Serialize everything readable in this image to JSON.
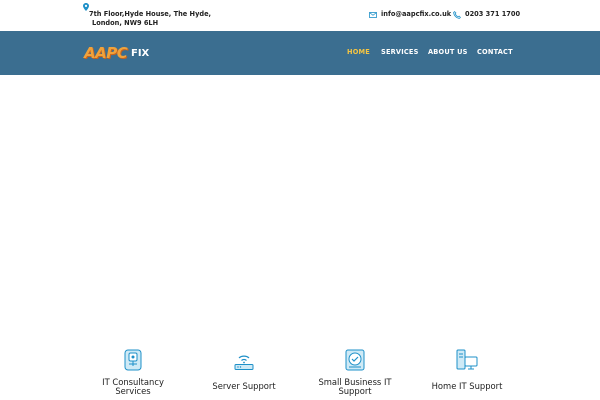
{
  "topbar": {
    "address_line1": "7th Floor,Hyde House, The Hyde,",
    "address_line2": "London, NW9 6LH",
    "email": "info@aapcfix.co.uk",
    "phone": "0203 371 1700",
    "icons": [
      "map-pin-icon",
      "envelope-icon",
      "phone-icon"
    ],
    "accent_color": "#1e90c8"
  },
  "navbar": {
    "background": "#3b6e90",
    "logo_main": "AAPC",
    "logo_suffix": "FIX",
    "items": [
      {
        "label": "HOME",
        "active": true
      },
      {
        "label": "SERVICES",
        "active": false
      },
      {
        "label": "ABOUT US",
        "active": false
      },
      {
        "label": "CONTACT",
        "active": false
      }
    ],
    "active_color": "#f5c542"
  },
  "services": [
    {
      "label_line1": "IT Consultancy",
      "label_line2": "Services",
      "icon": "it-consultancy-icon"
    },
    {
      "label_line1": "Server Support",
      "label_line2": "",
      "icon": "server-router-icon"
    },
    {
      "label_line1": "Small Business IT",
      "label_line2": "Support",
      "icon": "business-support-icon"
    },
    {
      "label_line1": "Home IT Support",
      "label_line2": "",
      "icon": "home-computer-icon"
    }
  ]
}
